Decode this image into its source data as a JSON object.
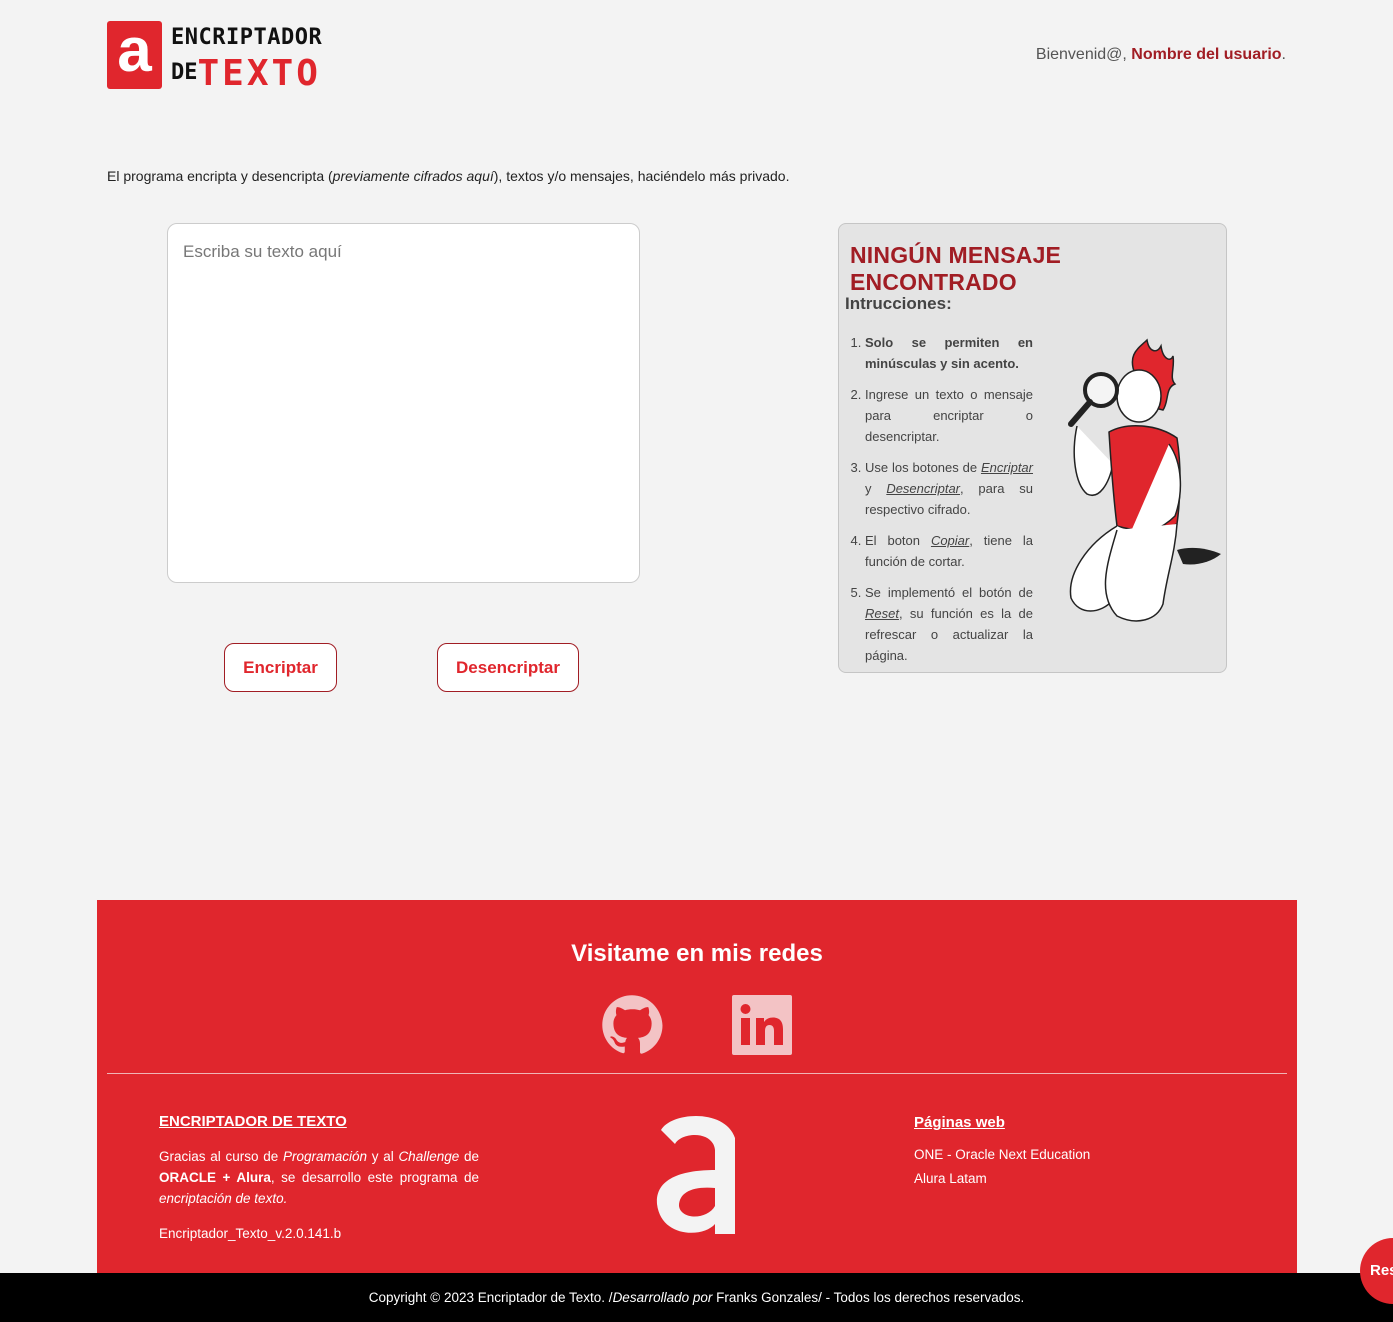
{
  "header": {
    "logo_mark": "a",
    "logo_line1": "ENCRIPTADOR",
    "logo_line2_small": "DE",
    "logo_line2_big": "TEXTO",
    "welcome_prefix": "Bienvenid@, ",
    "user_name": "Nombre del usuario",
    "welcome_suffix": "."
  },
  "intro": {
    "part1": "El programa encripta y desencripta (",
    "italic": "previamente cifrados aquí",
    "part2": "), textos y/o mensajes, haciéndelo más privado."
  },
  "editor": {
    "placeholder": "Escriba su texto aquí",
    "encrypt_label": "Encriptar",
    "decrypt_label": "Desencriptar"
  },
  "result_panel": {
    "title": "NINGÚN MENSAJE ENCONTRADO",
    "subtitle": "Intrucciones:",
    "steps": [
      {
        "bold": "Solo se permiten en minúsculas y sin acento."
      },
      {
        "text": "Ingrese un texto o mensaje para encriptar o desencriptar."
      },
      {
        "a": "Use los botones de ",
        "u1": "Encriptar",
        "b": " y ",
        "u2": "Desencriptar",
        "c": ", para su respectivo cifrado."
      },
      {
        "a": "El boton ",
        "u1": "Copiar",
        "c": ", tiene la función de cortar."
      },
      {
        "a": "Se implementó el botón de ",
        "u1": "Reset",
        "c": ", su función es la de refrescar o actualizar la página."
      }
    ]
  },
  "footer": {
    "social_title": "Visitame en mis redes",
    "col1_heading": "ENCRIPTADOR DE TEXTO",
    "col1_t1": "Gracias al curso de ",
    "col1_i1": "Programación",
    "col1_t2": " y al ",
    "col1_i2": "Challenge",
    "col1_t3": " de ",
    "col1_b1": "ORACLE + Alura",
    "col1_t4": ", se desarrollo este programa de ",
    "col1_i3": "encriptación de texto.",
    "version": "Encriptador_Texto_v.2.0.141.b",
    "logo_mark": "a",
    "col3_heading": "Páginas web",
    "link1": "ONE - Oracle Next Education",
    "link2": "Alura Latam"
  },
  "bottom_bar": {
    "t1": "Copyright © 2023 Encriptador de Texto. /",
    "i1": "Desarrollado por",
    "t2": " Franks Gonzales/ - Todos los derechos reservados."
  },
  "reset_label": "Reset",
  "colors": {
    "brand_red": "#e0262d",
    "dark_red": "#a11d24",
    "background": "#f3f3f3"
  }
}
